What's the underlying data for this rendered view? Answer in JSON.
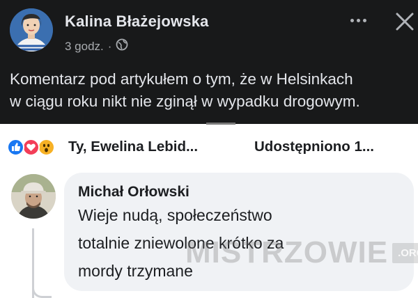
{
  "post": {
    "author_name": "Kalina Błażejowska",
    "time": "3 godz.",
    "separator": "·",
    "text_line1": "Komentarz pod artykułem o tym, że w Helsinkach",
    "text_line2": "w ciągu roku nikt nie zginął w wypadku drogowym.",
    "actions": {
      "more_icon": "more-horizontal-icon",
      "close_icon": "close-icon"
    },
    "privacy_icon": "globe-icon"
  },
  "reactions": {
    "icons": [
      "like-icon",
      "love-icon",
      "wow-icon"
    ],
    "reactors_text": "Ty, Ewelina Lebid...",
    "shares_text": "Udostępniono 1..."
  },
  "comment": {
    "author_name": "Michał Orłowski",
    "lines": [
      "Wieje nudą, społeczeństwo",
      "totalnie zniewolone krótko za",
      "mordy trzymane"
    ]
  },
  "watermark": {
    "text": "MISTRZOWIE",
    "suffix": ".ORG"
  },
  "colors": {
    "panel_bg": "#18191a",
    "panel_text": "#e4e6eb",
    "panel_muted": "#a8abaf",
    "like": "#1877f2",
    "love": "#f33e58",
    "wow": "#f7b125",
    "bubble_bg": "#f0f2f5"
  }
}
